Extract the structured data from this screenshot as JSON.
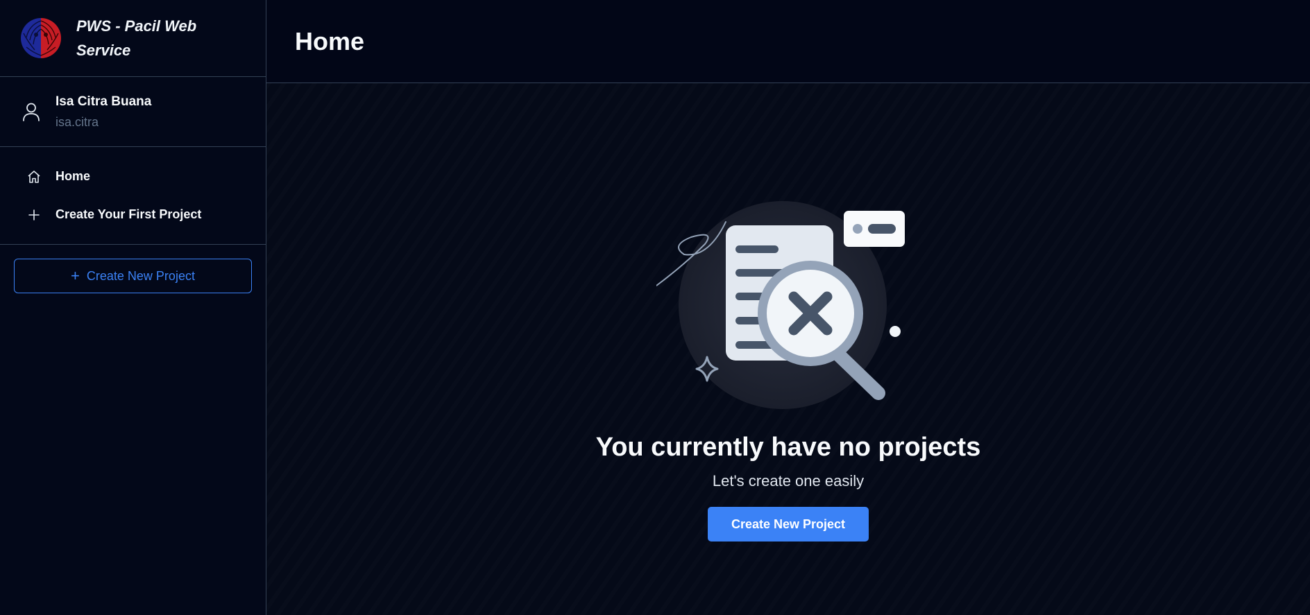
{
  "brand": {
    "title": "PWS - Pacil Web Service",
    "logo_icon": "university-emblem-icon"
  },
  "user": {
    "name": "Isa Citra Buana",
    "handle": "isa.citra",
    "icon": "user-icon"
  },
  "nav": {
    "items": [
      {
        "label": "Home",
        "icon": "home-icon"
      },
      {
        "label": "Create Your First Project",
        "icon": "plus-icon"
      }
    ]
  },
  "sidebar_cta": {
    "label": "Create New Project",
    "icon": "plus-icon"
  },
  "header": {
    "title": "Home"
  },
  "empty_state": {
    "illustration": "document-search-no-results-icon",
    "title": "You currently have no projects",
    "subtitle": "Let's create one easily",
    "button_label": "Create New Project"
  },
  "colors": {
    "background": "#020617",
    "sidebar": "#030819",
    "border": "#334155",
    "accent": "#3b82f6",
    "muted_text": "#64748b"
  }
}
